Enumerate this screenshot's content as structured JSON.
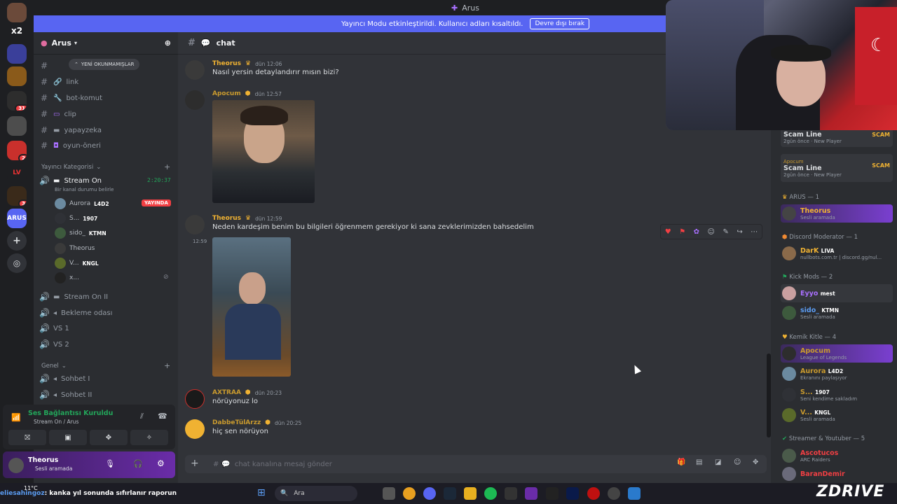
{
  "window": {
    "title": "Arus"
  },
  "banner": {
    "text": "Yayıncı Modu etkinleştirildi. Kullanıcı adları kısaltıldı.",
    "button": "Devre dışı bırak"
  },
  "guild": {
    "name": "Arus"
  },
  "sidebar": {
    "unread_pill": "YENİ OKUNMAMIŞLAR",
    "text_channels": [
      {
        "name": "link"
      },
      {
        "name": "bot-komut"
      },
      {
        "name": "clip"
      },
      {
        "name": "yapayzeka"
      },
      {
        "name": "oyun-öneri"
      }
    ],
    "streamer_category": "Yayıncı Kategorisi",
    "stream_channel": {
      "name": "Stream On",
      "timer": "2:20:37",
      "status": "Bir kanal durumu belirle"
    },
    "voice_users": [
      {
        "name": "Aurora",
        "tag": "L4D2",
        "badge": "YAYINDA"
      },
      {
        "name": "S...",
        "tag": "1907"
      },
      {
        "name": "sido_",
        "tag": "KTMN"
      },
      {
        "name": "Theorus",
        "tag": ""
      },
      {
        "name": "V...",
        "tag": "KNGL"
      },
      {
        "name": "x...",
        "tag": ""
      }
    ],
    "voice_channels": [
      "Stream On II",
      "Bekleme odası",
      "VS 1",
      "VS 2"
    ],
    "general_category": "Genel",
    "general_channels": [
      "Sohbet I",
      "Sohbet II"
    ]
  },
  "voice_status": {
    "title": "Ses Bağlantısı Kuruldu",
    "channel": "Stream On / Arus"
  },
  "user": {
    "name": "Theorus",
    "status": "Sesli aramada"
  },
  "chat": {
    "channel": "chat",
    "placeholder": "chat kanalına mesaj gönder",
    "messages": [
      {
        "author": "Theorus",
        "time": "dün 12:06",
        "text": "Nasıl yersin detaylandırır mısın bizi?",
        "color": "#f0b232"
      },
      {
        "author": "Apocum",
        "time": "dün 12:57",
        "text": "",
        "color": "#c99a2e"
      },
      {
        "author": "Theorus",
        "time": "dün 12:59",
        "text": "Neden kardeşim benim bu bilgileri öğrenmem gerekiyor ki sana zevklerimizden bahsedelim",
        "color": "#f0b232",
        "side_time": "12:59"
      },
      {
        "author": "AXTRAA",
        "time": "dün 20:23",
        "text": "nörüyonuz lo",
        "color": "#c99a2e"
      },
      {
        "author": "DabbeTülArzz",
        "time": "dün 20:25",
        "text": "hiç sen nörüyon",
        "color": "#c99a2e"
      }
    ]
  },
  "members": {
    "top": [
      {
        "name": "Scam Line",
        "status": "2gün önce",
        "extra": "New Player"
      },
      {
        "name": "Scam Line",
        "status": "2gün önce",
        "extra": "New Player",
        "pre": "Apocum"
      }
    ],
    "groups": [
      {
        "label": "ARUS — 1",
        "members": [
          {
            "name": "Theorus",
            "status": "Sesli aramada",
            "color": "#f0b232"
          }
        ]
      },
      {
        "label": "Discord Moderator — 1",
        "members": [
          {
            "name": "DarK",
            "tag": "LIVA",
            "status": "nullbots.com.tr | discord.gg/nul...",
            "color": "#f0b232"
          }
        ]
      },
      {
        "label": "Kick Mods — 2",
        "members": [
          {
            "name": "Eyyo",
            "tag": "mest",
            "status": "",
            "color": "#a970ff"
          },
          {
            "name": "sido_",
            "tag": "KTMN",
            "status": "Sesli aramada",
            "color": "#5b9cf2"
          }
        ]
      },
      {
        "label": "Kemik Kitle — 4",
        "members": [
          {
            "name": "Apocum",
            "status": "League of Legends",
            "color": "#c99a2e"
          },
          {
            "name": "Aurora",
            "tag": "L4D2",
            "status": "Ekranını paylaşıyor",
            "color": "#c99a2e"
          },
          {
            "name": "S...",
            "tag": "1907",
            "status": "Seni kendime sakladım",
            "color": "#c99a2e"
          },
          {
            "name": "V...",
            "tag": "KNGL",
            "status": "Sesli aramada",
            "color": "#c99a2e"
          }
        ]
      },
      {
        "label": "Streamer & Youtuber — 5",
        "members": [
          {
            "name": "Ascotucos",
            "status": "ARC Raiders",
            "color": "#f23f43"
          },
          {
            "name": "BaranDemir",
            "status": "",
            "color": "#f23f43"
          }
        ]
      }
    ]
  },
  "taskbar": {
    "weather": "11°C",
    "search": "Ara",
    "ticker_user": "eliesahingoz",
    "ticker_text": ": kanka yıl sonunda sıfırlanır raporun",
    "overlay_brand": "ZDRIVE"
  },
  "colors": {
    "blurple": "#5865f2",
    "bg": "#313338",
    "sidebar": "#2b2d31",
    "green": "#23a55a",
    "red": "#f23f43"
  }
}
